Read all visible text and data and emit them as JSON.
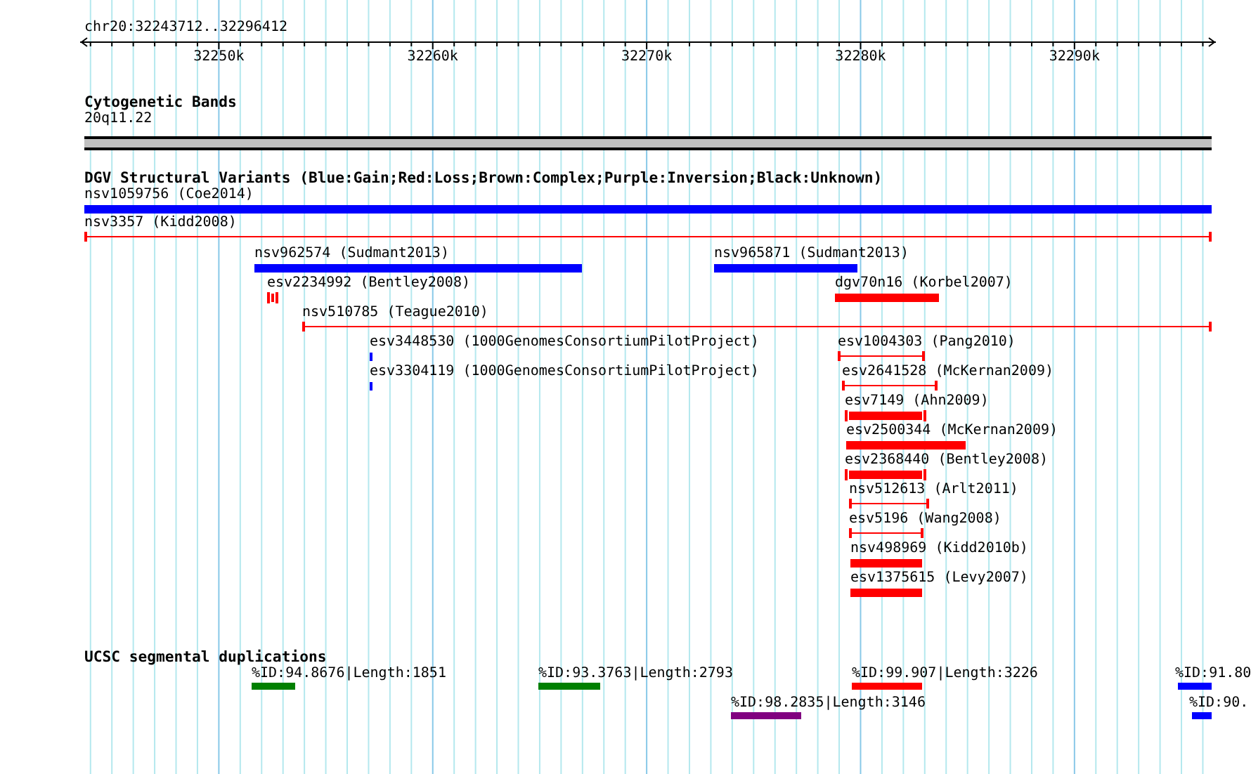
{
  "ruler": {
    "range": "chr20:32243712..32296412",
    "ticks": [
      "32250k",
      "32260k",
      "32270k",
      "32280k",
      "32290k"
    ]
  },
  "cytogenetic_bands": {
    "title": "Cytogenetic Bands",
    "band": {
      "label": "20q11.22"
    }
  },
  "dgv": {
    "title": "DGV Structural Variants (Blue:Gain;Red:Loss;Brown:Complex;Purple:Inversion;Black:Unknown)",
    "features": [
      {
        "label": "nsv1059756 (Coe2014)",
        "kind": "bar",
        "color": "#0000ff"
      },
      {
        "label": "nsv3357 (Kidd2008)",
        "kind": "line",
        "color": "#ff0000"
      },
      {
        "label": "nsv962574 (Sudmant2013)",
        "kind": "bar",
        "color": "#0000ff"
      },
      {
        "label": "nsv965871 (Sudmant2013)",
        "kind": "bar",
        "color": "#0000ff"
      },
      {
        "label": "esv2234992 (Bentley2008)",
        "kind": "capped",
        "color": "#ff0000"
      },
      {
        "label": "dgv70n16 (Korbel2007)",
        "kind": "bar",
        "color": "#ff0000"
      },
      {
        "label": "nsv510785 (Teague2010)",
        "kind": "line",
        "color": "#ff0000"
      },
      {
        "label": "esv3448530 (1000GenomesConsortiumPilotProject)",
        "kind": "tick",
        "color": "#0000ff"
      },
      {
        "label": "esv1004303 (Pang2010)",
        "kind": "line",
        "color": "#ff0000"
      },
      {
        "label": "esv3304119 (1000GenomesConsortiumPilotProject)",
        "kind": "tick",
        "color": "#0000ff"
      },
      {
        "label": "esv2641528 (McKernan2009)",
        "kind": "line",
        "color": "#ff0000"
      },
      {
        "label": "esv7149 (Ahn2009)",
        "kind": "capped",
        "color": "#ff0000"
      },
      {
        "label": "esv2500344 (McKernan2009)",
        "kind": "bar",
        "color": "#ff0000"
      },
      {
        "label": "esv2368440 (Bentley2008)",
        "kind": "capped",
        "color": "#ff0000"
      },
      {
        "label": "nsv512613 (Arlt2011)",
        "kind": "line",
        "color": "#ff0000"
      },
      {
        "label": "esv5196 (Wang2008)",
        "kind": "line",
        "color": "#ff0000"
      },
      {
        "label": "nsv498969 (Kidd2010b)",
        "kind": "bar",
        "color": "#ff0000"
      },
      {
        "label": "esv1375615 (Levy2007)",
        "kind": "bar",
        "color": "#ff0000"
      }
    ]
  },
  "segmental_duplications": {
    "title": "UCSC segmental duplications",
    "features": [
      {
        "label": "%ID:94.8676|Length:1851",
        "color": "#008000"
      },
      {
        "label": "%ID:93.3763|Length:2793",
        "color": "#008000"
      },
      {
        "label": "%ID:99.907|Length:3226",
        "color": "#ff0000"
      },
      {
        "label": "%ID:91.80",
        "color": "#0000ff"
      },
      {
        "label": "%ID:98.2835|Length:3146",
        "color": "#800080"
      },
      {
        "label": "%ID:90.",
        "color": "#0000ff"
      }
    ]
  }
}
